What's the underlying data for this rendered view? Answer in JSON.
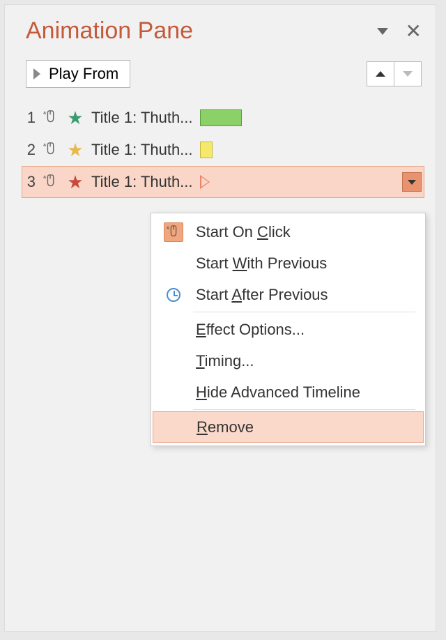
{
  "pane": {
    "title": "Animation Pane",
    "play_button": "Play From"
  },
  "animations": [
    {
      "index": "1",
      "label": "Title 1: Thuth...",
      "star_color": "green",
      "bar": "green"
    },
    {
      "index": "2",
      "label": "Title 1: Thuth...",
      "star_color": "yellow",
      "bar": "yellow"
    },
    {
      "index": "3",
      "label": "Title 1: Thuth...",
      "star_color": "red",
      "bar": "play-outline",
      "selected": true
    }
  ],
  "context_menu": {
    "items": [
      {
        "label_prefix": "Start On ",
        "accel": "C",
        "label_suffix": "lick",
        "icon": "mouse"
      },
      {
        "label_prefix": "Start ",
        "accel": "W",
        "label_suffix": "ith Previous",
        "icon": ""
      },
      {
        "label_prefix": "Start ",
        "accel": "A",
        "label_suffix": "fter Previous",
        "icon": "clock",
        "separator_after": true
      },
      {
        "label_prefix": "",
        "accel": "E",
        "label_suffix": "ffect Options...",
        "icon": ""
      },
      {
        "label_prefix": "",
        "accel": "T",
        "label_suffix": "iming...",
        "icon": ""
      },
      {
        "label_prefix": "",
        "accel": "H",
        "label_suffix": "ide Advanced Timeline",
        "icon": "",
        "separator_after": true
      },
      {
        "label_prefix": "",
        "accel": "R",
        "label_suffix": "emove",
        "icon": "",
        "highlighted": true
      }
    ]
  }
}
